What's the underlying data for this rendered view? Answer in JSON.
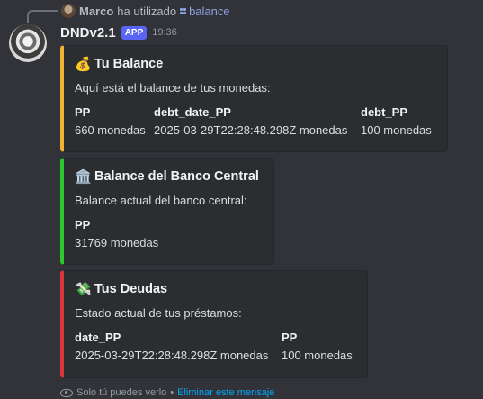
{
  "reply": {
    "user": "Marco",
    "action": "ha utilizado",
    "command": "balance"
  },
  "message": {
    "bot_name": "DNDv2.1",
    "badge": "APP",
    "time": "19:36"
  },
  "embeds": [
    {
      "emoji": "💰",
      "title": "Tu Balance",
      "color": "#f0b232",
      "description": "Aquí está el balance de tus monedas:",
      "fields": [
        {
          "name": "PP",
          "value": "660 monedas"
        },
        {
          "name": "debt_date_PP",
          "value": "2025-03-29T22:28:48.298Z monedas"
        },
        {
          "name": "debt_PP",
          "value": "100 monedas"
        }
      ]
    },
    {
      "emoji": "🏛️",
      "title": "Balance del Banco Central",
      "color": "#2ec82e",
      "description": "Balance actual del banco central:",
      "fields": [
        {
          "name": "PP",
          "value": "31769 monedas"
        }
      ]
    },
    {
      "emoji": "💸",
      "title": "Tus Deudas",
      "color": "#da373c",
      "description": "Estado actual de tus préstamos:",
      "fields": [
        {
          "name": "date_PP",
          "value": "2025-03-29T22:28:48.298Z monedas"
        },
        {
          "name": "PP",
          "value": "100 monedas"
        }
      ]
    }
  ],
  "footer": {
    "note": "Solo tú puedes verlo",
    "separator": "•",
    "dismiss_link": "Eliminar este mensaje"
  }
}
